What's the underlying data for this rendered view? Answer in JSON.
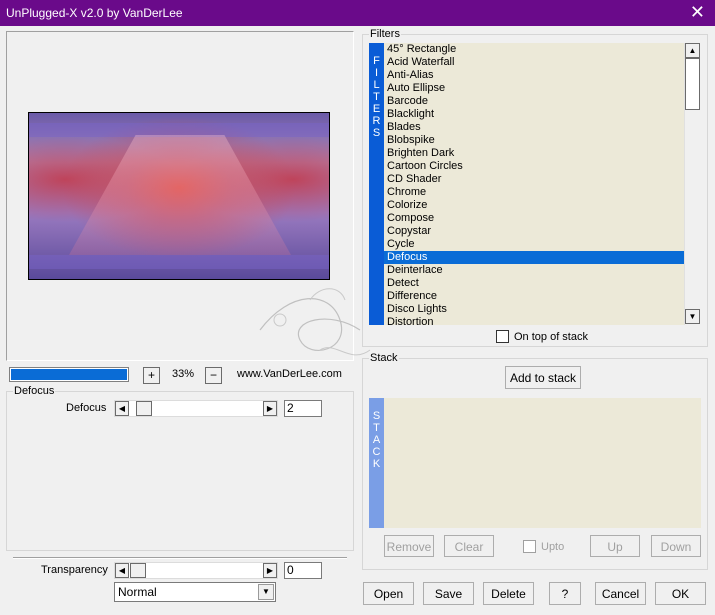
{
  "window": {
    "title": "UnPlugged-X v2.0 by VanDerLee"
  },
  "preview": {
    "progress_fraction": 1.0,
    "zoom_minus": "+",
    "zoom_level": "33%",
    "zoom_plus": "−",
    "website": "www.VanDerLee.com"
  },
  "defocus_group": {
    "label": "Defocus",
    "param_label": "Defocus",
    "param_value": "2"
  },
  "transparency": {
    "label": "Transparency",
    "value": "0",
    "blend_mode": "Normal"
  },
  "filters": {
    "label": "Filters",
    "tab_letters": [
      "F",
      "I",
      "L",
      "T",
      "E",
      "R",
      "S"
    ],
    "items": [
      "45° Rectangle",
      "Acid Waterfall",
      "Anti-Alias",
      "Auto Ellipse",
      "Barcode",
      "Blacklight",
      "Blades",
      "Blobspike",
      "Brighten Dark",
      "Cartoon Circles",
      "CD Shader",
      "Chrome",
      "Colorize",
      "Compose",
      "Copystar",
      "Cycle",
      "Defocus",
      "Deinterlace",
      "Detect",
      "Difference",
      "Disco Lights",
      "Distortion"
    ],
    "selected": "Defocus",
    "on_top_label": "On top of stack"
  },
  "stack": {
    "label": "Stack",
    "add_label": "Add to stack",
    "tab_letters": [
      "S",
      "T",
      "A",
      "C",
      "K"
    ],
    "remove_label": "Remove",
    "clear_label": "Clear",
    "upto_label": "Upto",
    "up_label": "Up",
    "down_label": "Down"
  },
  "footer": {
    "open": "Open",
    "save": "Save",
    "delete": "Delete",
    "help": "?",
    "cancel": "Cancel",
    "ok": "OK"
  },
  "colors": {
    "titlebar": "#6a0a8a",
    "accent": "#0a6cd6",
    "list_bg": "#ece9d8"
  },
  "icons": {
    "close": "close-icon",
    "left": "arrow-left-icon",
    "right": "arrow-right-icon",
    "up": "arrow-up-icon",
    "down": "arrow-down-icon",
    "dropdown": "chevron-down-icon"
  }
}
